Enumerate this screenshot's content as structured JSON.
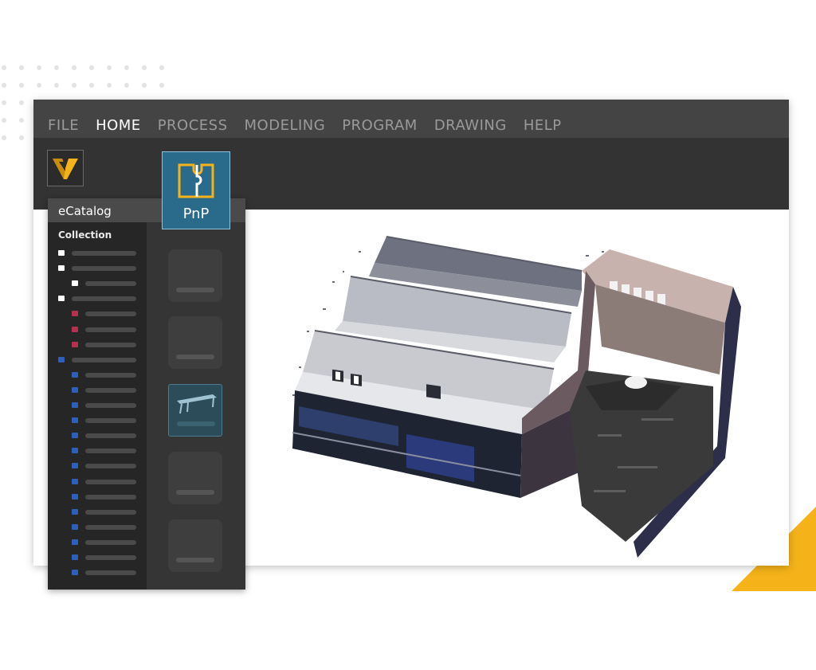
{
  "menu": {
    "items": [
      "FILE",
      "HOME",
      "PROCESS",
      "MODELING",
      "PROGRAM",
      "DRAWING",
      "HELP"
    ],
    "active": "HOME"
  },
  "ribbon": {
    "pnp_label": "PnP"
  },
  "ecatalog": {
    "title": "eCatalog",
    "collection_label": "Collection"
  },
  "colors": {
    "accent_yellow": "#f5b319",
    "pnp_blue": "#2a6a8a",
    "folder_white": "#ffffff",
    "folder_red": "#b3334f",
    "folder_blue": "#2f5fb8"
  },
  "icons": [
    "logo-v-icon",
    "puzzle-piece-icon",
    "folder-icon",
    "table-thumbnail-icon"
  ]
}
